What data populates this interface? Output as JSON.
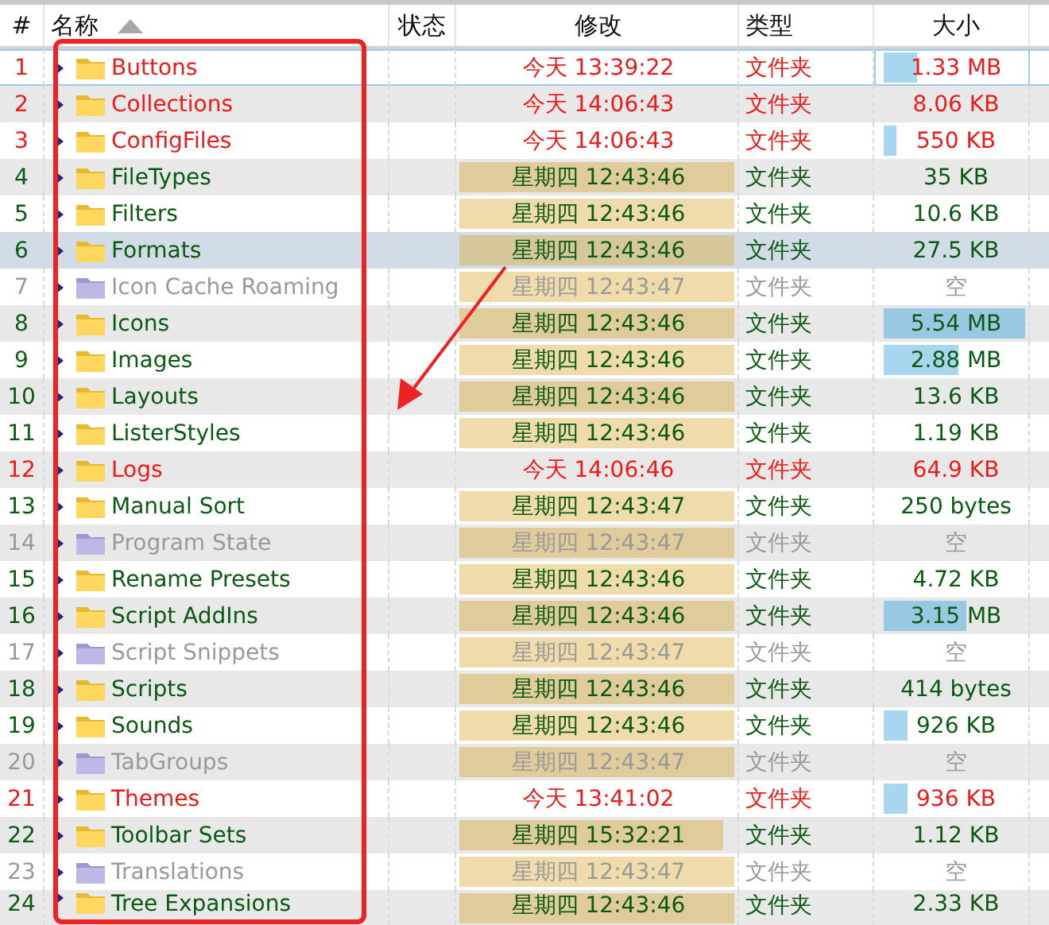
{
  "columns": [
    {
      "label": "#",
      "sorted": false
    },
    {
      "label": "名称",
      "sorted": true
    },
    {
      "label": "状态",
      "sorted": false
    },
    {
      "label": "修改",
      "sorted": false
    },
    {
      "label": "类型",
      "sorted": false
    },
    {
      "label": "大小",
      "sorted": false
    }
  ],
  "rows": [
    {
      "num": "1",
      "name": "Buttons",
      "kind": "recent",
      "selected": false,
      "focused": true,
      "modified": {
        "text": "今天 13:39:22"
      },
      "type": "文件夹",
      "size": {
        "text": "1.33 MB",
        "level": 0.22
      }
    },
    {
      "num": "2",
      "name": "Collections",
      "kind": "recent",
      "selected": false,
      "focused": false,
      "modified": {
        "text": "今天 14:06:43"
      },
      "type": "文件夹",
      "size": {
        "text": "8.06 KB"
      }
    },
    {
      "num": "3",
      "name": "ConfigFiles",
      "kind": "recent",
      "selected": false,
      "focused": false,
      "modified": {
        "text": "今天 14:06:43"
      },
      "type": "文件夹",
      "size": {
        "text": "550 KB",
        "level": 0.08
      }
    },
    {
      "num": "4",
      "name": "FileTypes",
      "kind": "normal",
      "selected": false,
      "focused": false,
      "modified": {
        "text": "星期四 12:43:46",
        "level": 1
      },
      "type": "文件夹",
      "size": {
        "text": "35 KB"
      }
    },
    {
      "num": "5",
      "name": "Filters",
      "kind": "normal",
      "selected": false,
      "focused": false,
      "modified": {
        "text": "星期四 12:43:46",
        "level": 1
      },
      "type": "文件夹",
      "size": {
        "text": "10.6 KB"
      }
    },
    {
      "num": "6",
      "name": "Formats",
      "kind": "normal",
      "selected": true,
      "focused": false,
      "modified": {
        "text": "星期四 12:43:46",
        "level": 1
      },
      "type": "文件夹",
      "size": {
        "text": "27.5 KB"
      }
    },
    {
      "num": "7",
      "name": "Icon Cache Roaming",
      "kind": "empty",
      "selected": false,
      "focused": false,
      "modified": {
        "text": "星期四 12:43:47",
        "level": 0.98
      },
      "type": "文件夹",
      "size": {
        "text": "空"
      }
    },
    {
      "num": "8",
      "name": "Icons",
      "kind": "normal",
      "selected": false,
      "focused": false,
      "modified": {
        "text": "星期四 12:43:46",
        "level": 1
      },
      "type": "文件夹",
      "size": {
        "text": "5.54 MB",
        "level": 0.98
      }
    },
    {
      "num": "9",
      "name": "Images",
      "kind": "normal",
      "selected": false,
      "focused": false,
      "modified": {
        "text": "星期四 12:43:46",
        "level": 1
      },
      "type": "文件夹",
      "size": {
        "text": "2.88 MB",
        "level": 0.48
      }
    },
    {
      "num": "10",
      "name": "Layouts",
      "kind": "normal",
      "selected": false,
      "focused": false,
      "modified": {
        "text": "星期四 12:43:46",
        "level": 1
      },
      "type": "文件夹",
      "size": {
        "text": "13.6 KB"
      }
    },
    {
      "num": "11",
      "name": "ListerStyles",
      "kind": "normal",
      "selected": false,
      "focused": false,
      "modified": {
        "text": "星期四 12:43:46",
        "level": 1
      },
      "type": "文件夹",
      "size": {
        "text": "1.19 KB"
      }
    },
    {
      "num": "12",
      "name": "Logs",
      "kind": "recent",
      "selected": false,
      "focused": false,
      "modified": {
        "text": "今天 14:06:46"
      },
      "type": "文件夹",
      "size": {
        "text": "64.9 KB"
      }
    },
    {
      "num": "13",
      "name": "Manual Sort",
      "kind": "normal",
      "selected": false,
      "focused": false,
      "modified": {
        "text": "星期四 12:43:47",
        "level": 0.98
      },
      "type": "文件夹",
      "size": {
        "text": "250 bytes"
      }
    },
    {
      "num": "14",
      "name": "Program State",
      "kind": "empty",
      "selected": false,
      "focused": false,
      "modified": {
        "text": "星期四 12:43:47",
        "level": 0.98
      },
      "type": "文件夹",
      "size": {
        "text": "空"
      }
    },
    {
      "num": "15",
      "name": "Rename Presets",
      "kind": "normal",
      "selected": false,
      "focused": false,
      "modified": {
        "text": "星期四 12:43:46",
        "level": 1
      },
      "type": "文件夹",
      "size": {
        "text": "4.72 KB"
      }
    },
    {
      "num": "16",
      "name": "Script AddIns",
      "kind": "normal",
      "selected": false,
      "focused": false,
      "modified": {
        "text": "星期四 12:43:46",
        "level": 1
      },
      "type": "文件夹",
      "size": {
        "text": "3.15 MB",
        "level": 0.54
      }
    },
    {
      "num": "17",
      "name": "Script Snippets",
      "kind": "empty",
      "selected": false,
      "focused": false,
      "modified": {
        "text": "星期四 12:43:47",
        "level": 0.98
      },
      "type": "文件夹",
      "size": {
        "text": "空"
      }
    },
    {
      "num": "18",
      "name": "Scripts",
      "kind": "normal",
      "selected": false,
      "focused": false,
      "modified": {
        "text": "星期四 12:43:46",
        "level": 1
      },
      "type": "文件夹",
      "size": {
        "text": "414 bytes"
      }
    },
    {
      "num": "19",
      "name": "Sounds",
      "kind": "normal",
      "selected": false,
      "focused": false,
      "modified": {
        "text": "星期四 12:43:46",
        "level": 1
      },
      "type": "文件夹",
      "size": {
        "text": "926 KB",
        "level": 0.15
      }
    },
    {
      "num": "20",
      "name": "TabGroups",
      "kind": "empty",
      "selected": false,
      "focused": false,
      "modified": {
        "text": "星期四 12:43:47",
        "level": 0.98
      },
      "type": "文件夹",
      "size": {
        "text": "空"
      }
    },
    {
      "num": "21",
      "name": "Themes",
      "kind": "recent",
      "selected": false,
      "focused": false,
      "modified": {
        "text": "今天 13:41:02"
      },
      "type": "文件夹",
      "size": {
        "text": "936 KB",
        "level": 0.15
      }
    },
    {
      "num": "22",
      "name": "Toolbar Sets",
      "kind": "normal",
      "selected": false,
      "focused": false,
      "modified": {
        "text": "星期四 15:32:21",
        "level": 0.94
      },
      "type": "文件夹",
      "size": {
        "text": "1.12 KB"
      }
    },
    {
      "num": "23",
      "name": "Translations",
      "kind": "empty",
      "selected": false,
      "focused": false,
      "modified": {
        "text": "星期四 12:43:47",
        "level": 0.98
      },
      "type": "文件夹",
      "size": {
        "text": "空"
      }
    },
    {
      "num": "24",
      "name": "Tree Expansions",
      "kind": "normal",
      "selected": false,
      "focused": false,
      "modified": {
        "text": "星期四 12:43:46",
        "level": 1
      },
      "type": "文件夹",
      "size": {
        "text": "2.33 KB"
      }
    }
  ]
}
